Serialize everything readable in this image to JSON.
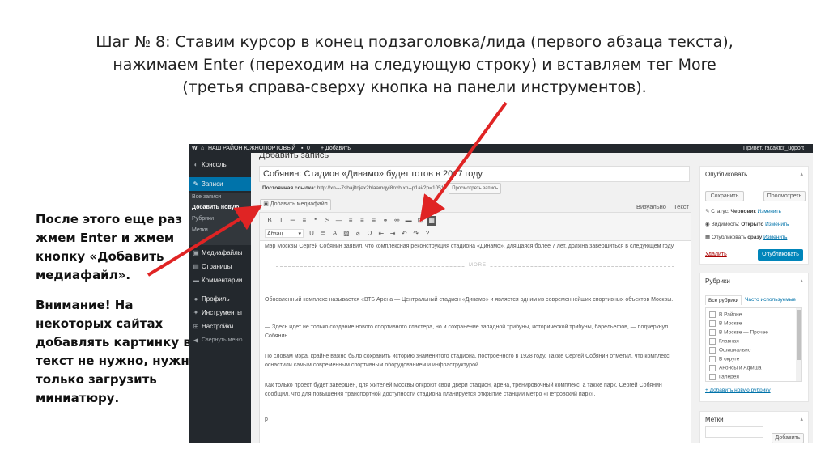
{
  "slide": {
    "title_lines": [
      "Шаг № 8: Ставим курсор в конец подзаголовка/лида (первого абзаца текста),",
      "нажимаем Enter (переходим на следующую строку) и вставляем тег More",
      "(третья справа-сверху кнопка на панели инструментов)."
    ],
    "note_1_lines": [
      "После этого еще раз",
      "жмем Enter и жмем",
      "кнопку «Добавить",
      "медиафайл»."
    ],
    "note_2_lines": [
      "Внимание! На",
      "некоторых сайтах",
      "добавлять картинку в",
      "текст не нужно, нужно",
      "только загрузить",
      "миниатюру."
    ],
    "arrow_color": "#e02424"
  },
  "admin_bar": {
    "logo": "W",
    "site_name": "НАШ РАЙОН ЮЖНОПОРТОВЫЙ",
    "comments_count": "0",
    "new_label": "+ Добавить",
    "greeting": "Привет, racaktcr_ugport"
  },
  "sidebar": {
    "items": [
      {
        "icon": "gauge-icon",
        "glyph": "◐",
        "label": "Консоль"
      },
      {
        "icon": "pin-icon",
        "glyph": "✎",
        "label": "Записи",
        "active": true
      },
      {
        "icon": "media-icon",
        "glyph": "▣",
        "label": "Медиафайлы"
      },
      {
        "icon": "pages-icon",
        "glyph": "▤",
        "label": "Страницы"
      },
      {
        "icon": "comments-icon",
        "glyph": "▬",
        "label": "Комментарии"
      },
      {
        "icon": "user-icon",
        "glyph": "●",
        "label": "Профиль"
      },
      {
        "icon": "wrench-icon",
        "glyph": "✦",
        "label": "Инструменты"
      },
      {
        "icon": "settings-icon",
        "glyph": "⊞",
        "label": "Настройки"
      },
      {
        "icon": "collapse-icon",
        "glyph": "◀",
        "label": "Свернуть меню"
      }
    ],
    "submenu": [
      "Все записи",
      "Добавить новую",
      "Рубрики",
      "Метки"
    ]
  },
  "editor": {
    "page_title": "Добавить запись",
    "post_title": "Собянин: Стадион «Динамо» будет готов в 2017 году",
    "permalink_label": "Постоянная ссылка:",
    "permalink_url": "http://xn---7sbajltnjex2blaamqyi8nxb.xn--p1ai/?p=1051",
    "permalink_button": "Просмотреть запись",
    "add_media_label": "Добавить медиафайл",
    "tab_visual": "Визуально",
    "tab_text": "Текст",
    "format_select": "Абзац",
    "more_label": "MORE",
    "paragraphs": [
      "Мэр Москвы Сергей Собянин заявил, что комплексная реконструкция стадиона «Динамо», длящаяся более 7 лет, должна завершиться в следующем году",
      "Обновленный комплекс называется «ВТБ Арена — Центральный стадион «Динамо» и является одним из современнейших спортивных объектов Москвы.",
      "— Здесь идет не только создание нового спортивного кластера, но и сохранение западной трибуны, исторической трибуны, барельефов, — подчеркнул Собянин.",
      "По словам мэра, крайне важно было сохранить историю знаменитого стадиона, построенного в 1928 году. Также Сергей Собянин отметил, что комплекс оснастили самым современным спортивным оборудованием и инфраструктурой.",
      "Как только проект будет завершен, для жителей Москвы откроют свои двери стадион, арена, тренировочный комплекс, а также парк. Сергей Собянин сообщил, что для повышения транспортной доступности стадиона планируется открытие станции метро «Петровский парк»."
    ],
    "status_path": "p",
    "toolbar_row1": [
      {
        "name": "bold-button",
        "glyph": "B"
      },
      {
        "name": "italic-button",
        "glyph": "I"
      },
      {
        "name": "bullet-list-button",
        "glyph": "☰"
      },
      {
        "name": "numbered-list-button",
        "glyph": "≡"
      },
      {
        "name": "blockquote-button",
        "glyph": "❝"
      },
      {
        "name": "strikethrough-button",
        "glyph": "S"
      },
      {
        "name": "hr-button",
        "glyph": "—"
      },
      {
        "name": "align-left-button",
        "glyph": "≡"
      },
      {
        "name": "align-center-button",
        "glyph": "≡"
      },
      {
        "name": "align-right-button",
        "glyph": "≡"
      },
      {
        "name": "link-button",
        "glyph": "⚭"
      },
      {
        "name": "unlink-button",
        "glyph": "⚮"
      },
      {
        "name": "insert-more-button",
        "glyph": "▬"
      },
      {
        "name": "fullscreen-button",
        "glyph": "⊡"
      },
      {
        "name": "kitchen-sink-button",
        "glyph": "▦",
        "on": true
      }
    ],
    "toolbar_row2": [
      {
        "name": "underline-button",
        "glyph": "U"
      },
      {
        "name": "justify-button",
        "glyph": "≣"
      },
      {
        "name": "text-color-button",
        "glyph": "A"
      },
      {
        "name": "paste-text-button",
        "glyph": "▨"
      },
      {
        "name": "clear-format-button",
        "glyph": "⌀"
      },
      {
        "name": "special-char-button",
        "glyph": "Ω"
      },
      {
        "name": "outdent-button",
        "glyph": "⇤"
      },
      {
        "name": "indent-button",
        "glyph": "⇥"
      },
      {
        "name": "undo-button",
        "glyph": "↶"
      },
      {
        "name": "redo-button",
        "glyph": "↷"
      },
      {
        "name": "help-button",
        "glyph": "?"
      }
    ]
  },
  "publish": {
    "heading": "Опубликовать",
    "save_label": "Сохранить",
    "preview_label": "Просмотреть",
    "status_label": "Статус:",
    "status_value": "Черновик",
    "visibility_label": "Видимость:",
    "visibility_value": "Открыто",
    "schedule_label": "Опубликовать",
    "schedule_value": "сразу",
    "edit_link": "Изменить",
    "delete_label": "Удалить",
    "publish_label": "Опубликовать"
  },
  "categories": {
    "heading": "Рубрики",
    "tab_all": "Все рубрики",
    "tab_popular": "Часто используемые",
    "items": [
      "В Районе",
      "В Москве",
      "В Москве — Прочее",
      "Главная",
      "Официально",
      "В округе",
      "Анонсы и Афиша",
      "Галерея"
    ],
    "add_link": "+ Добавить новую рубрику"
  },
  "tags": {
    "heading": "Метки",
    "add_label": "Добавить"
  }
}
